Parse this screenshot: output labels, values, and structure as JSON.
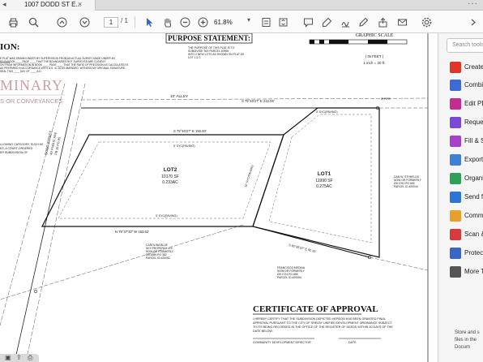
{
  "tab": {
    "title": "1007 DODD ST E...",
    "close": "×"
  },
  "toolbar": {
    "page_current": "1",
    "page_total": "/ 1",
    "zoom": "61.8%"
  },
  "document": {
    "purpose_title": "PURPOSE STATEMENT:",
    "purpose_text": [
      "THE PURPOSE OF THIS PLAT IS TO",
      "SUBDIVIDE TAX PARCEL 40966",
      "INTO 2 NEW LOTS AS SHOWN ON PLAT AS",
      "LOT 1 & 2."
    ],
    "graphic_scale": "GRAPHIC SCALE",
    "scale_unit": "( IN FEET )",
    "scale_ratio": "1 inch = 20 ft.",
    "prelim_word": "MINARY",
    "prelim_sub": "S OR CONVEYANCES",
    "left_header": "ION:",
    "cert_lines": [
      "E PLAT WAS DRAWN UNDER MY SUPERVISION FROM AN ACTUAL SURVEY MADE UNDER MY",
      "ED IN BOOK ____ PAGE ____ THAT THE BOUNDARIES NOT SURVEYED ARE CLEARLY",
      "ON FROM INFORMATION IN BOOK ____ PAGE ____ THAT THE RATIO OF PRECISION AS CALCULATED IS",
      "AS PREPARED IN ACCORDANCE WITH G.S. 47-30 AS AMENDED. WITNESS MY ORIGINAL SIGNATURE,",
      "SEAL THIS ____ DAY OF ____ A.D.,"
    ],
    "left_notes": [
      "LLOWING CATEGORY, SUCH AS",
      "ES, A COURT-ORDERED",
      "ER SUBDIVISION OF"
    ],
    "alley": "10' ALLEY",
    "bearing_top": "S 79°40'27\" E   212.06'",
    "bearing_lot2": "S 79°40'27\" E   150.00'",
    "bearing_bottom": "N 79°37'33\" W   153.62'",
    "bearing_sub": "S 82°35'37\" E   92.20'",
    "pin_label": "IP PIPE",
    "setback_top2": "5' SYC(PAVING)",
    "setback_bot2": "5' SYC(PAVING)",
    "setback_top1": "5' SYC(PAVING)",
    "setback_side": "10' SYC(PAVING)",
    "lot2_title": "LOT2",
    "lot2_sf": "10170 SF",
    "lot2_ac": "0.233AC",
    "lot1_title": "LOT1",
    "lot1_sf": "11990 SF",
    "lot1_ac": "0.275AC",
    "road_name": "DODD STREET",
    "road_sub": "40' PUBLIC R/W",
    "road_book": "PB 19 PG 95",
    "east_owner": [
      "DAN W. STHHELDS",
      "NOW OR FORMERLY",
      "DB 1761 PG 650",
      "PARCEL ID #20044"
    ],
    "south_owner": [
      "CAROLINA BLUE",
      "SKY PROPERTY LLC",
      "NOW OR FORMERLY",
      "DB 1689 PG 382",
      "PARCEL ID #20052"
    ],
    "south_owner2": [
      "FRANCISCO MEDINA",
      "NOW OR FORMERLY",
      "DB 1724 PG 569",
      "PARCEL ID #20054"
    ],
    "approval_title": "CERTIFICATE OF APPROVAL",
    "approval_lines": [
      "I HEREBY CERTIFY THAT THE SUBDIVISION DEPICTED HEREON HAS BEEN GRANTED FINAL",
      "APPROVAL PURSUANT TO THE CITY OF SHELBY UNIFIED DEVELOPMENT ORDINANCE SUBJECT",
      "TO ITS BEING RECORDED IN THE OFFICE OF THE REGISTER OF DEEDS WITHIN 30 DAYS OF THE",
      "DATE BELOW."
    ],
    "approval_sig": "COMMUNITY DEVELOPMENT DIRECTOR",
    "approval_date": "DATE"
  },
  "pane": {
    "search_placeholder": "Search tools",
    "tools": [
      {
        "label": "Create",
        "color": "#e0352b",
        "icon": "create-pdf-icon"
      },
      {
        "label": "Combi",
        "color": "#3d6bd6",
        "icon": "combine-files-icon"
      },
      {
        "label": "Edit PD",
        "color": "#c62b8e",
        "icon": "edit-pdf-icon"
      },
      {
        "label": "Reques",
        "color": "#7a49d6",
        "icon": "request-signature-icon"
      },
      {
        "label": "Fill & S",
        "color": "#a542c9",
        "icon": "fill-sign-icon"
      },
      {
        "label": "Export",
        "color": "#3d80d6",
        "icon": "export-pdf-icon"
      },
      {
        "label": "Organi",
        "color": "#2fa05a",
        "icon": "organize-pages-icon"
      },
      {
        "label": "Send fo",
        "color": "#2e73d6",
        "icon": "send-for-comments-icon"
      },
      {
        "label": "Comme",
        "color": "#e8a02a",
        "icon": "comment-icon"
      },
      {
        "label": "Scan &",
        "color": "#d63a3a",
        "icon": "scan-ocr-icon"
      },
      {
        "label": "Protect",
        "color": "#3a66c6",
        "icon": "protect-icon"
      },
      {
        "label": "More T",
        "color": "#555555",
        "icon": "more-tools-icon"
      }
    ],
    "footer": [
      "Store and s",
      "files in the",
      "Docum"
    ]
  }
}
